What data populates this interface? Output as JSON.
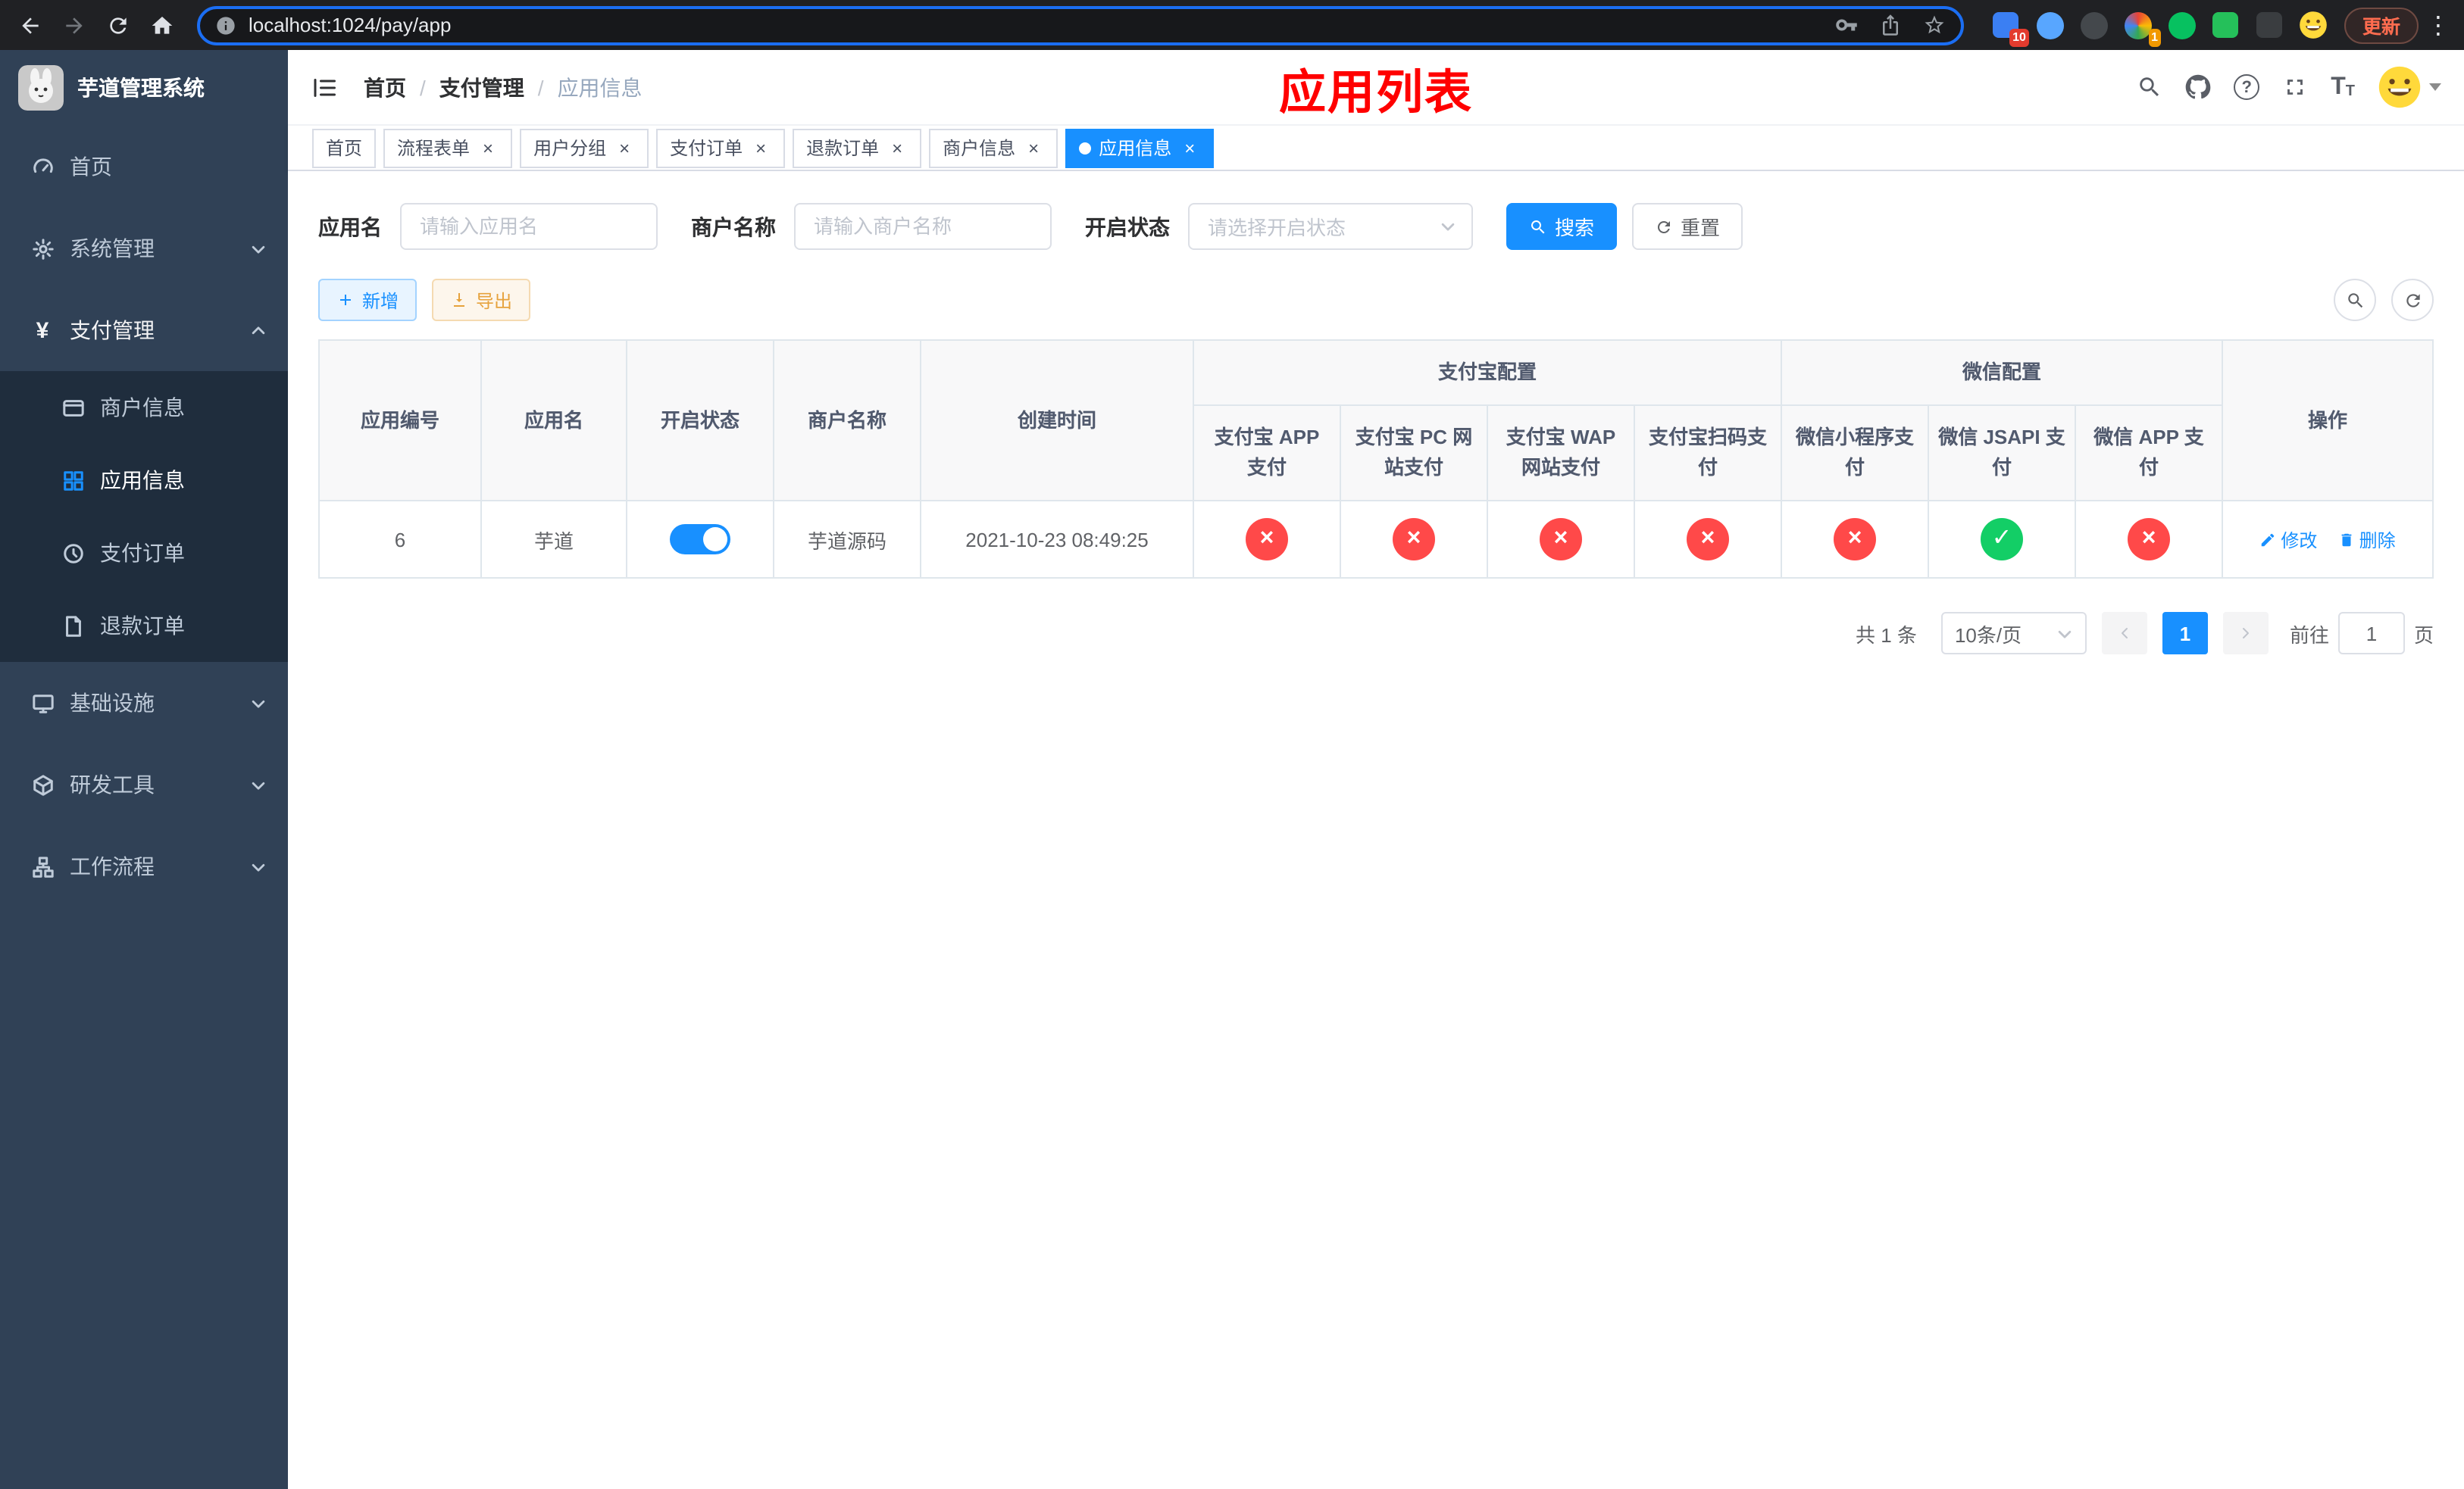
{
  "colors": {
    "accent": "#1890ff",
    "page_title": "#ff0000",
    "danger": "#ff4949",
    "success": "#13ce66",
    "warning": "#e6a23c",
    "sidebar_bg": "#304156",
    "submenu_bg": "#1f2d3d"
  },
  "icons": {
    "check_glyph": "✓",
    "close_glyph": "×",
    "tag_close": "×",
    "active_tag_dot": "dot"
  },
  "browser": {
    "url": "localhost:1024/pay/app",
    "update_label": "更新",
    "extension_badge_count": "10",
    "notification_badge": "1"
  },
  "sidebar": {
    "logo_title": "芋道管理系统",
    "menu": [
      {
        "label": "首页"
      },
      {
        "label": "系统管理"
      },
      {
        "label": "支付管理",
        "children": [
          {
            "label": "商户信息"
          },
          {
            "label": "应用信息"
          },
          {
            "label": "支付订单"
          },
          {
            "label": "退款订单"
          }
        ]
      },
      {
        "label": "基础设施"
      },
      {
        "label": "研发工具"
      },
      {
        "label": "工作流程"
      }
    ]
  },
  "header": {
    "breadcrumb": [
      "首页",
      "支付管理",
      "应用信息"
    ],
    "separator": "/",
    "title": "应用列表"
  },
  "tags": [
    {
      "label": "首页",
      "closable": false,
      "active": false
    },
    {
      "label": "流程表单",
      "closable": true,
      "active": false
    },
    {
      "label": "用户分组",
      "closable": true,
      "active": false
    },
    {
      "label": "支付订单",
      "closable": true,
      "active": false
    },
    {
      "label": "退款订单",
      "closable": true,
      "active": false
    },
    {
      "label": "商户信息",
      "closable": true,
      "active": false
    },
    {
      "label": "应用信息",
      "closable": true,
      "active": true
    }
  ],
  "filters": {
    "app_name_label": "应用名",
    "app_name_placeholder": "请输入应用名",
    "merchant_label": "商户名称",
    "merchant_placeholder": "请输入商户名称",
    "status_label": "开启状态",
    "status_placeholder": "请选择开启状态",
    "search_label": "搜索",
    "reset_label": "重置"
  },
  "toolbar": {
    "add_label": "新增",
    "export_label": "导出"
  },
  "table": {
    "groups": {
      "alipay": "支付宝配置",
      "wechat": "微信配置"
    },
    "columns": {
      "id": "应用编号",
      "name": "应用名",
      "status": "开启状态",
      "merchant": "商户名称",
      "created": "创建时间",
      "alipay_app": "支付宝 APP 支付",
      "alipay_pc": "支付宝 PC 网站支付",
      "alipay_wap": "支付宝 WAP 网站支付",
      "alipay_qr": "支付宝扫码支付",
      "wx_mini": "微信小程序支付",
      "wx_jsapi": "微信 JSAPI 支付",
      "wx_app": "微信 APP 支付",
      "ops": "操作"
    },
    "row": {
      "id": "6",
      "name": "芋道",
      "enabled": true,
      "merchant": "芋道源码",
      "created": "2021-10-23 08:49:25",
      "channels": [
        "disabled",
        "disabled",
        "disabled",
        "disabled",
        "disabled",
        "enabled",
        "disabled"
      ],
      "edit_label": "修改",
      "delete_label": "删除"
    }
  },
  "pagination": {
    "total": "共 1 条",
    "page_size": "10条/页",
    "current_page": "1",
    "goto_label": "前往",
    "goto_value": "1",
    "goto_suffix": "页"
  }
}
